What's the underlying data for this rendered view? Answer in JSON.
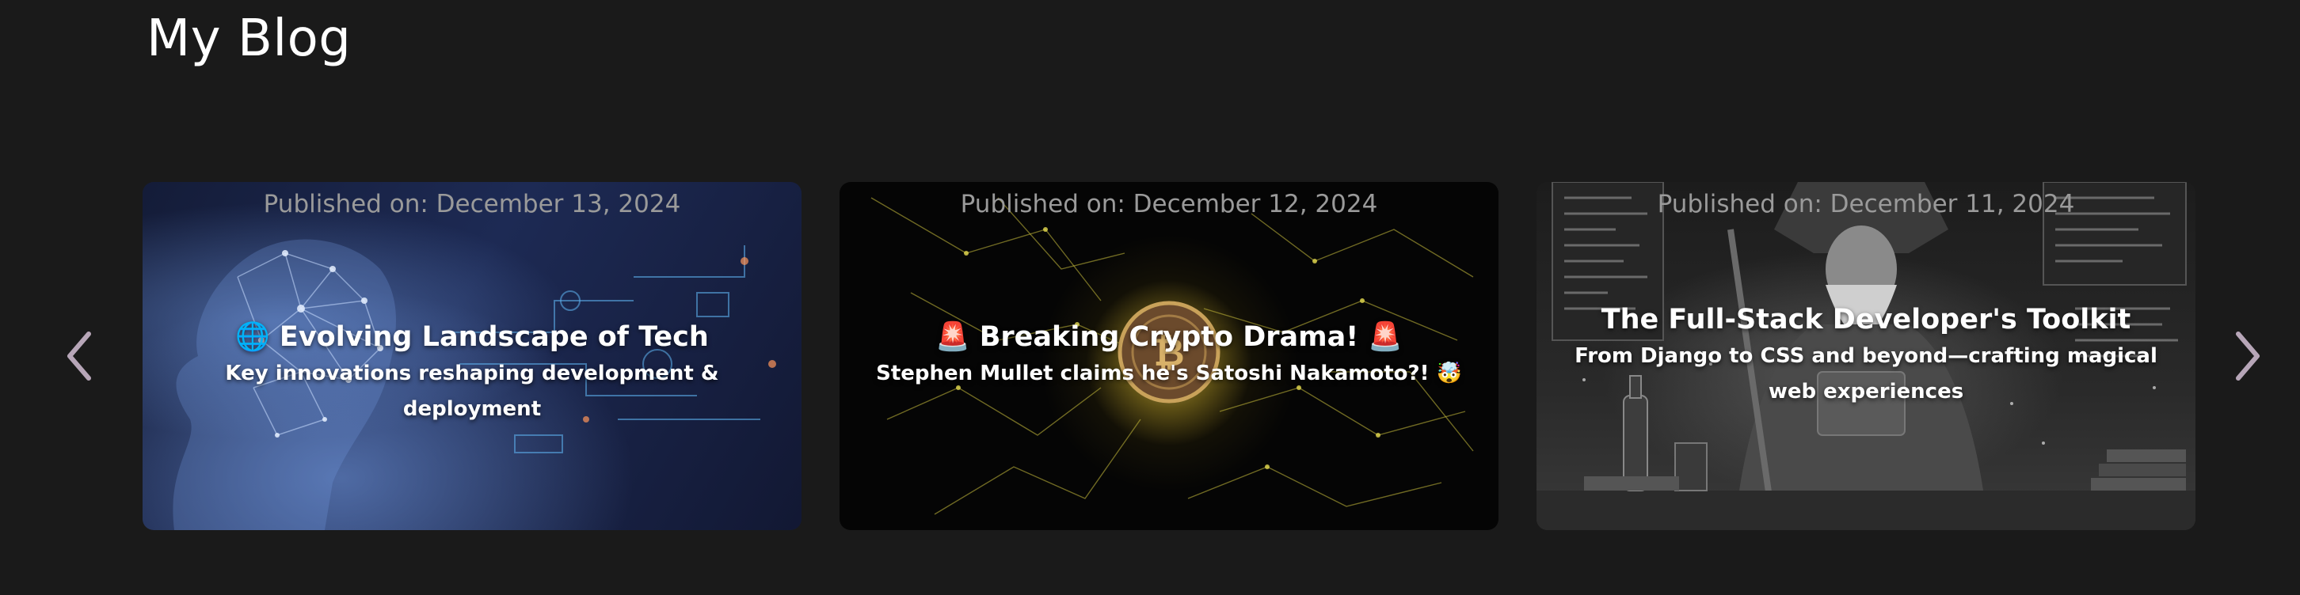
{
  "header": {
    "title": "My Blog"
  },
  "carousel": {
    "prev_icon": "chevron-left-icon",
    "next_icon": "chevron-right-icon",
    "arrow_color": "#b7a6b8",
    "posts": [
      {
        "published": "Published on: December 13, 2024",
        "title": "🌐 Evolving Landscape of Tech",
        "subtitle": "Key innovations reshaping development & deployment",
        "image": "ai-network-head-image"
      },
      {
        "published": "Published on: December 12, 2024",
        "title": "🚨 Breaking Crypto Drama! 🚨",
        "subtitle": "Stephen Mullet claims he's Satoshi Nakamoto?! 🤯",
        "image": "bitcoin-circuit-image"
      },
      {
        "published": "Published on: December 11, 2024",
        "title": "The Full-Stack Developer's Toolkit",
        "subtitle": "From Django to CSS and beyond—crafting magical web experiences",
        "image": "wizard-developer-image"
      }
    ]
  }
}
